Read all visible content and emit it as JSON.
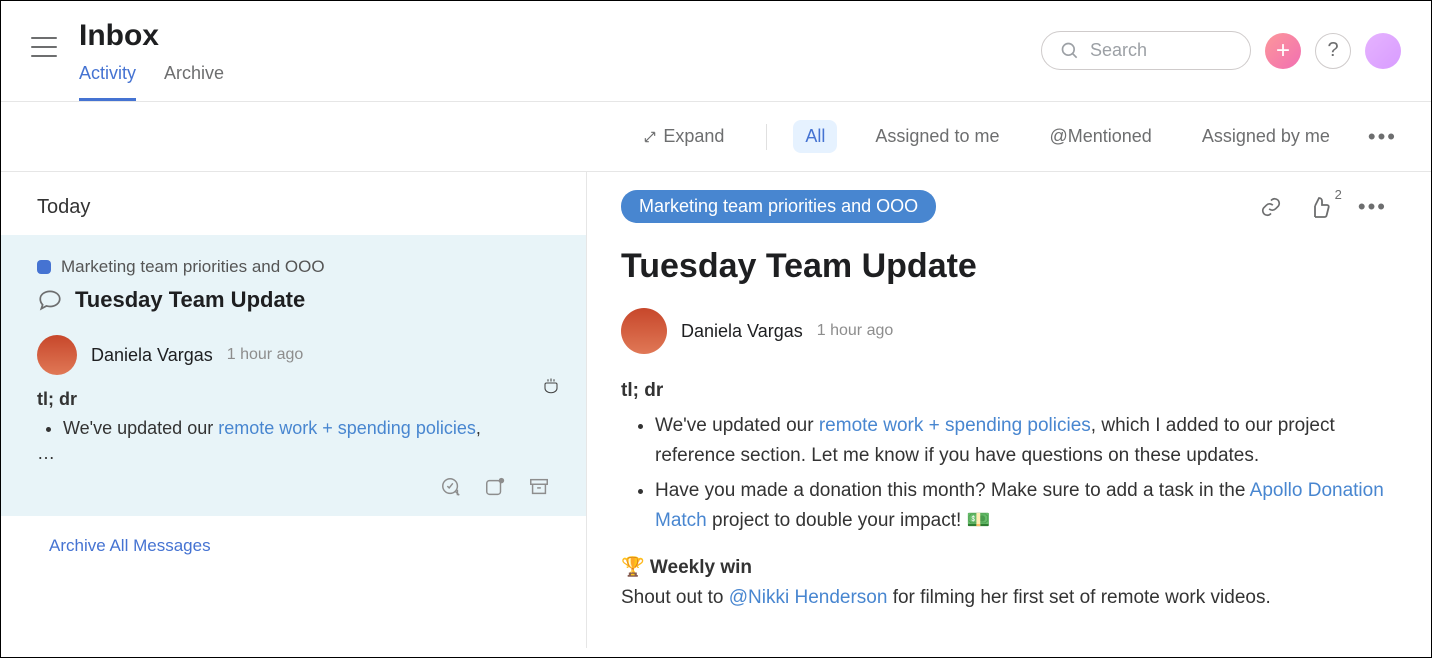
{
  "header": {
    "title": "Inbox",
    "tabs": [
      {
        "label": "Activity",
        "active": true
      },
      {
        "label": "Archive",
        "active": false
      }
    ],
    "search_placeholder": "Search",
    "help_label": "?"
  },
  "filters": {
    "expand": "Expand",
    "items": [
      {
        "label": "All",
        "active": true
      },
      {
        "label": "Assigned to me",
        "active": false
      },
      {
        "label": "@Mentioned",
        "active": false
      },
      {
        "label": "Assigned by me",
        "active": false
      }
    ]
  },
  "list": {
    "section": "Today",
    "item": {
      "project": "Marketing team priorities and OOO",
      "title": "Tuesday Team Update",
      "author": "Daniela Vargas",
      "time": "1 hour ago",
      "tldr": "tl; dr",
      "bullet_prefix": "We've updated our ",
      "bullet_link": "remote work + spending policies",
      "bullet_suffix": ",",
      "truncate": "…"
    },
    "archive_all": "Archive All Messages"
  },
  "detail": {
    "pill": "Marketing team priorities and OOO",
    "like_count": "2",
    "title": "Tuesday Team Update",
    "author": "Daniela Vargas",
    "time": "1 hour ago",
    "tldr": "tl; dr",
    "bullets": [
      {
        "pre": "We've updated our ",
        "link": "remote work + spending policies",
        "post": ", which I added to our project reference section. Let me know if you have questions on these updates."
      },
      {
        "pre": "Have you made a donation this month? Make sure to add a task in the ",
        "link": "Apollo Donation Match",
        "post": " project to double your impact! 💵"
      }
    ],
    "weekly_heading": "🏆 Weekly win",
    "shoutout_pre": "Shout out to ",
    "shoutout_mention": "@Nikki Henderson",
    "shoutout_post": " for filming her first set of remote work videos."
  }
}
